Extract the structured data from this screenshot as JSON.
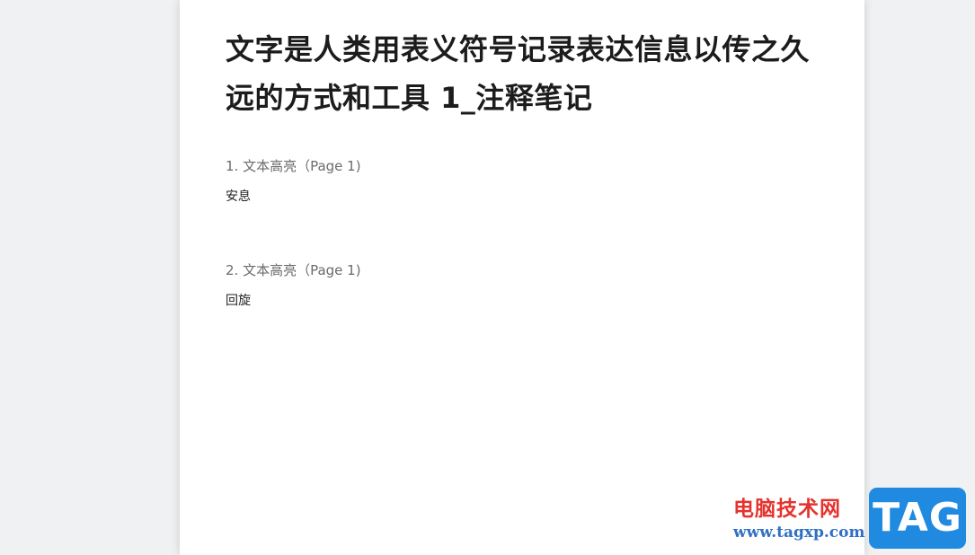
{
  "document": {
    "title": "文字是人类用表义符号记录表达信息以传之久远的方式和工具 1_注释笔记"
  },
  "notes": [
    {
      "heading": "1. 文本高亮（Page 1)",
      "content": "安息"
    },
    {
      "heading": "2. 文本高亮（Page 1)",
      "content": "回旋"
    }
  ],
  "watermark": {
    "site_name": "电脑技术网",
    "url": "www.tagxp.com",
    "logo_text": "TAG",
    "colors": {
      "site_name": "#e5322d",
      "url": "#2f6fc4",
      "logo_bg": "#1f8ae0"
    }
  }
}
